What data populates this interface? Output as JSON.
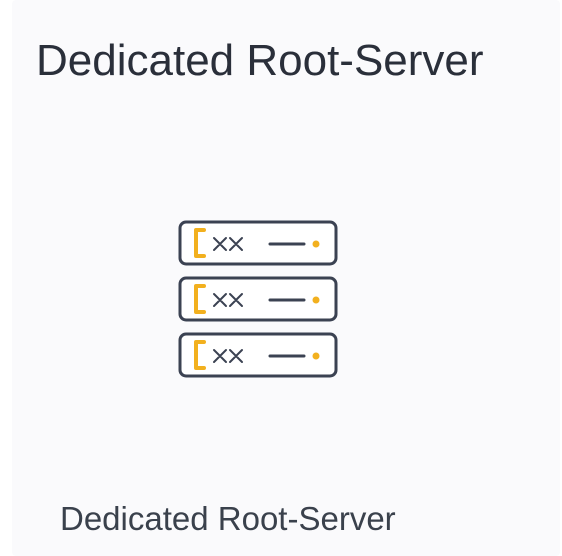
{
  "card": {
    "title": "Dedicated Root-Server",
    "icon": "server-rack-icon",
    "caption": "Dedicated Root-Server"
  },
  "colors": {
    "background": "#fafafc",
    "text": "#2a2f3a",
    "icon_stroke": "#3b4252",
    "icon_accent": "#f2b01e"
  }
}
